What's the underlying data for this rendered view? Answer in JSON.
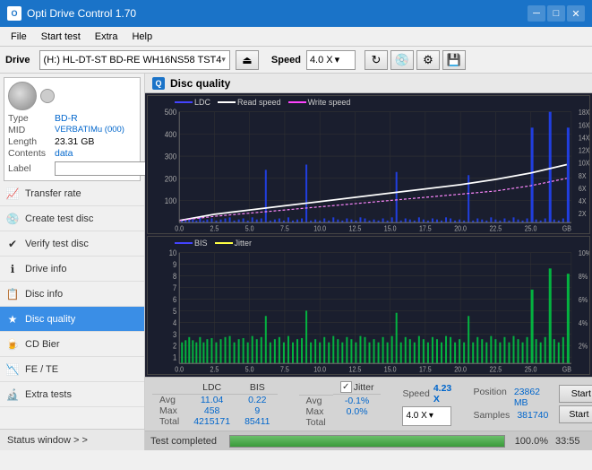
{
  "titleBar": {
    "title": "Opti Drive Control 1.70",
    "iconText": "O",
    "minimizeLabel": "─",
    "maximizeLabel": "□",
    "closeLabel": "✕"
  },
  "menuBar": {
    "items": [
      "File",
      "Start test",
      "Extra",
      "Help"
    ]
  },
  "driveBar": {
    "driveLabel": "Drive",
    "driveValue": "(H:)  HL-DT-ST BD-RE  WH16NS58 TST4",
    "speedLabel": "Speed",
    "speedValue": "4.0 X",
    "speedArrow": "▾"
  },
  "sidebar": {
    "discInfo": {
      "typeLabel": "Type",
      "typeValue": "BD-R",
      "midLabel": "MID",
      "midValue": "VERBATIMu (000)",
      "lengthLabel": "Length",
      "lengthValue": "23.31 GB",
      "contentsLabel": "Contents",
      "contentsValue": "data",
      "labelLabel": "Label",
      "labelValue": ""
    },
    "navItems": [
      {
        "id": "transfer-rate",
        "label": "Transfer rate",
        "icon": "📈"
      },
      {
        "id": "create-test-disc",
        "label": "Create test disc",
        "icon": "💿"
      },
      {
        "id": "verify-test-disc",
        "label": "Verify test disc",
        "icon": "✔"
      },
      {
        "id": "drive-info",
        "label": "Drive info",
        "icon": "ℹ"
      },
      {
        "id": "disc-info",
        "label": "Disc info",
        "icon": "📋"
      },
      {
        "id": "disc-quality",
        "label": "Disc quality",
        "icon": "★",
        "active": true
      },
      {
        "id": "cd-bier",
        "label": "CD Bier",
        "icon": "🍺"
      },
      {
        "id": "fe-te",
        "label": "FE / TE",
        "icon": "📉"
      },
      {
        "id": "extra-tests",
        "label": "Extra tests",
        "icon": "🔬"
      }
    ],
    "statusWindow": "Status window > >"
  },
  "discQuality": {
    "title": "Disc quality",
    "iconText": "Q",
    "chart1": {
      "legend": [
        {
          "label": "LDC",
          "color": "#4444ff"
        },
        {
          "label": "Read speed",
          "color": "#ffffff"
        },
        {
          "label": "Write speed",
          "color": "#ff44ff"
        }
      ],
      "yMax": 500,
      "yLabels": [
        "500",
        "400",
        "300",
        "200",
        "100"
      ],
      "rightLabels": [
        "18X",
        "16X",
        "14X",
        "12X",
        "10X",
        "8X",
        "6X",
        "4X",
        "2X"
      ],
      "xMax": 25,
      "xLabels": [
        "0.0",
        "2.5",
        "5.0",
        "7.5",
        "10.0",
        "12.5",
        "15.0",
        "17.5",
        "20.0",
        "22.5",
        "25.0"
      ]
    },
    "chart2": {
      "legend": [
        {
          "label": "BIS",
          "color": "#4444ff"
        },
        {
          "label": "Jitter",
          "color": "#ffff00"
        }
      ],
      "yMax": 10,
      "yLabels": [
        "10",
        "9",
        "8",
        "7",
        "6",
        "5",
        "4",
        "3",
        "2",
        "1"
      ],
      "rightLabels": [
        "10%",
        "8%",
        "6%",
        "4%",
        "2%"
      ],
      "xMax": 25,
      "xLabels": [
        "0.0",
        "2.5",
        "5.0",
        "7.5",
        "10.0",
        "12.5",
        "15.0",
        "17.5",
        "20.0",
        "22.5",
        "25.0"
      ]
    }
  },
  "statsBar": {
    "columns": [
      "LDC",
      "BIS"
    ],
    "rows": [
      {
        "label": "Avg",
        "ldc": "11.04",
        "bis": "0.22"
      },
      {
        "label": "Max",
        "ldc": "458",
        "bis": "9"
      },
      {
        "label": "Total",
        "ldc": "4215171",
        "bis": "85411"
      }
    ],
    "jitter": {
      "checked": true,
      "label": "Jitter",
      "checkmark": "✓",
      "rows": [
        {
          "label": "Avg",
          "value": "-0.1%"
        },
        {
          "label": "Max",
          "value": "0.0%"
        },
        {
          "label": "Total",
          "value": ""
        }
      ]
    },
    "speed": {
      "label": "Speed",
      "value": "4.23 X",
      "selectValue": "4.0 X"
    },
    "position": {
      "posLabel": "Position",
      "posValue": "23862 MB",
      "samplesLabel": "Samples",
      "samplesValue": "381740"
    },
    "buttons": {
      "startFull": "Start full",
      "startPart": "Start part"
    }
  },
  "progressBar": {
    "statusText": "Test completed",
    "progressPercent": 100,
    "progressLabel": "100.0%",
    "timeText": "33:55"
  }
}
